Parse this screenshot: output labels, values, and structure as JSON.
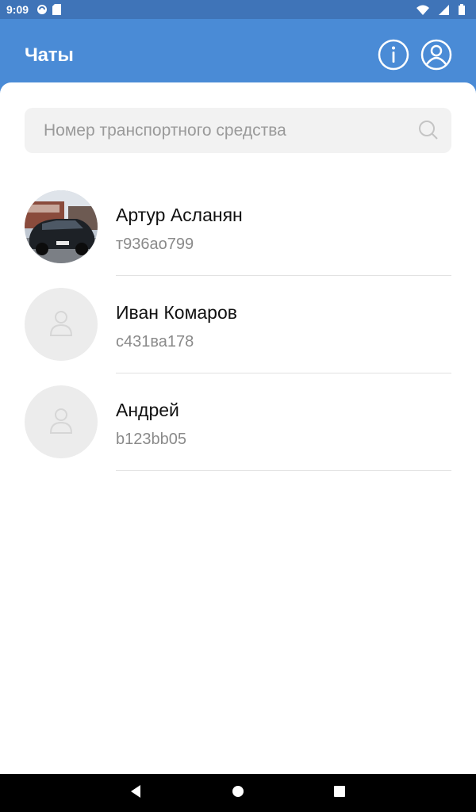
{
  "status_bar": {
    "time": "9:09"
  },
  "app_bar": {
    "title": "Чаты",
    "info_icon": "info-icon",
    "profile_icon": "profile-icon"
  },
  "search": {
    "placeholder": "Номер транспортного средства",
    "icon": "search-icon"
  },
  "chats": [
    {
      "name": "Артур Асланян",
      "plate": "т936ао799",
      "avatar": "car-photo"
    },
    {
      "name": "Иван Комаров",
      "plate": "с431ва178",
      "avatar": "person-placeholder-icon"
    },
    {
      "name": "Андрей",
      "plate": "b123bb05",
      "avatar": "person-placeholder-icon"
    }
  ],
  "colors": {
    "app_bar": "#4a8bd6",
    "status_bar": "#3f74b8",
    "text_primary": "#111111",
    "text_secondary": "#8a8a8a"
  }
}
